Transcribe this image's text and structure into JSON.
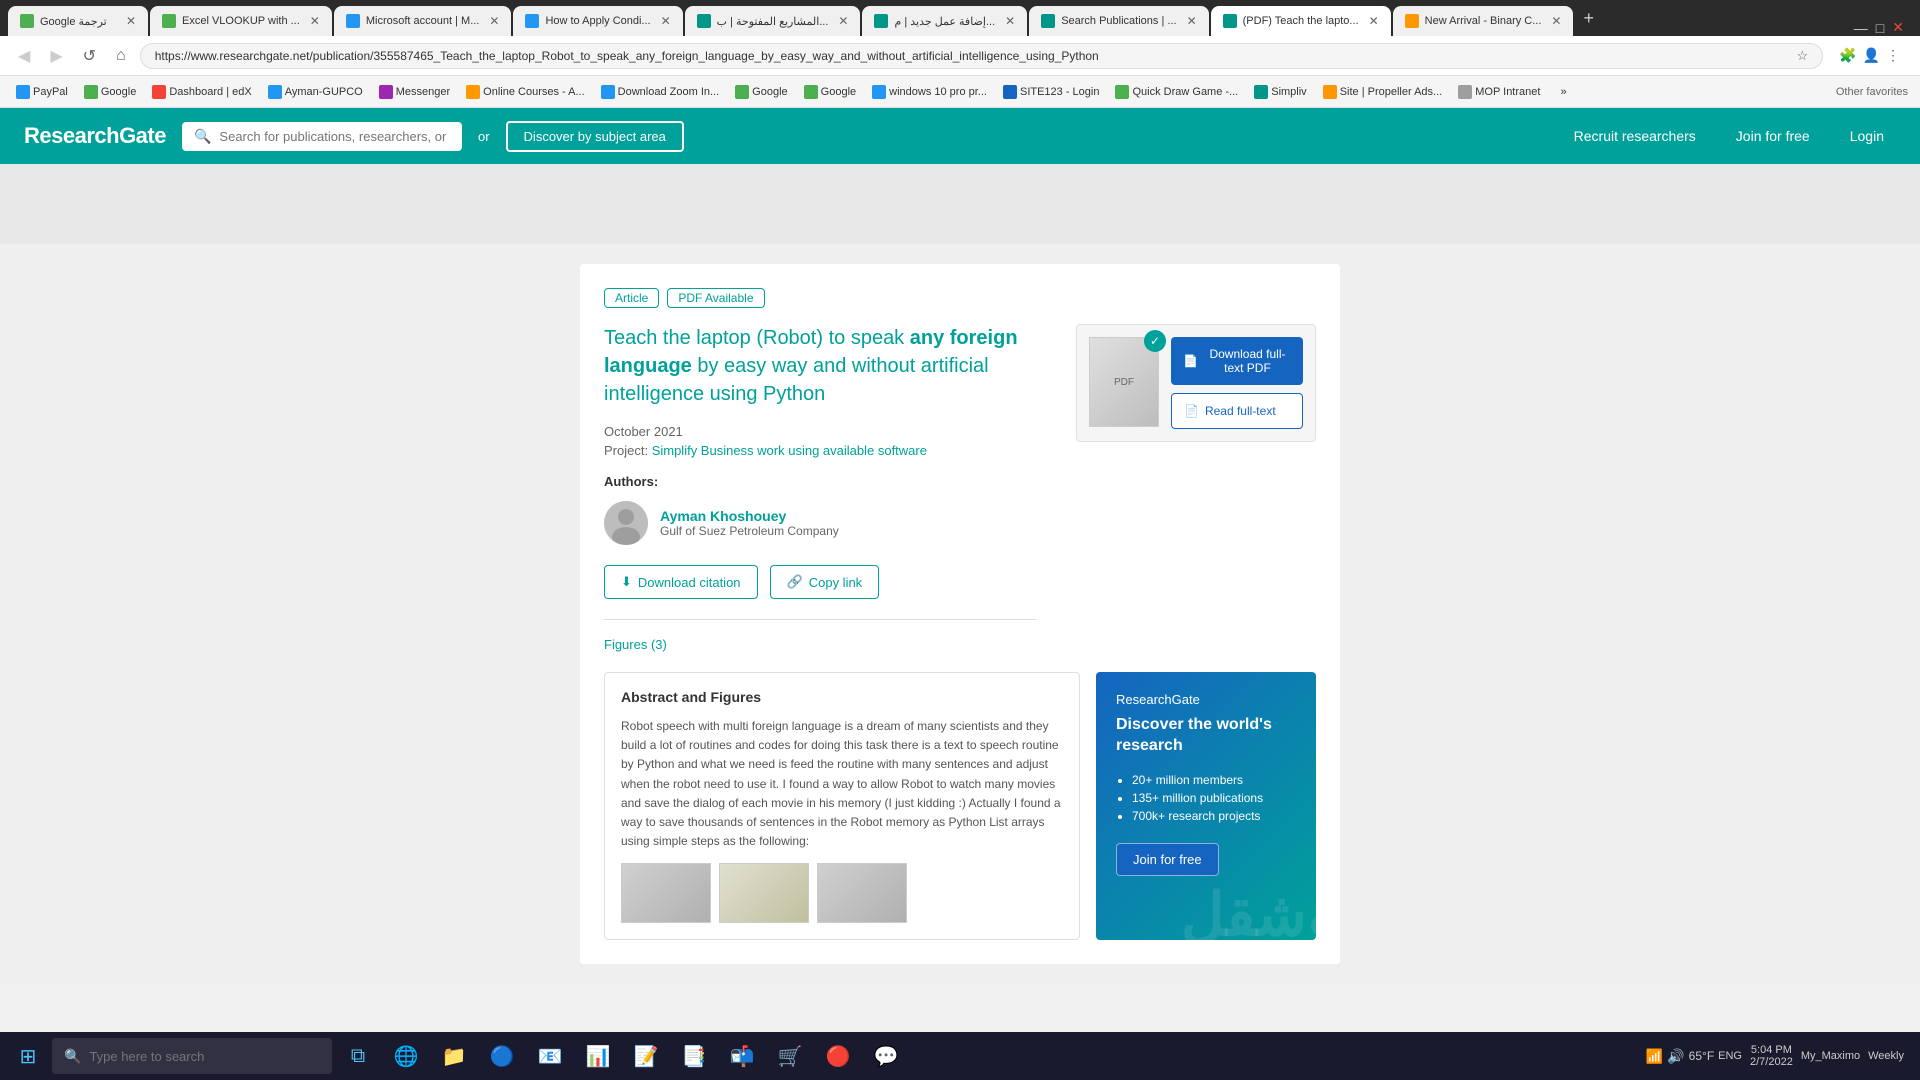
{
  "browser": {
    "tabs": [
      {
        "label": "Google ترجمة",
        "icon": "google",
        "active": false
      },
      {
        "label": "Excel VLOOKUP with ...",
        "icon": "excel",
        "active": false
      },
      {
        "label": "Microsoft account | M...",
        "icon": "ms",
        "active": false
      },
      {
        "label": "How to Apply Condi...",
        "icon": "chrome",
        "active": false
      },
      {
        "label": "المشاريع المفتوحة | ب...",
        "icon": "chrome",
        "active": false
      },
      {
        "label": "إضافة عمل جديد | م...",
        "icon": "chrome",
        "active": false
      },
      {
        "label": "Search Publications | ...",
        "icon": "rg",
        "active": false
      },
      {
        "label": "(PDF) Teach the lapto...",
        "icon": "rg",
        "active": true
      },
      {
        "label": "New Arrival - Binary C...",
        "icon": "chrome",
        "active": false
      }
    ],
    "url": "https://www.researchgate.net/publication/355587465_Teach_the_laptop_Robot_to_speak_any_foreign_language_by_easy_way_and_without_artificial_intelligence_using_Python"
  },
  "bookmarks": [
    {
      "label": "PayPal",
      "color": "blue"
    },
    {
      "label": "Google",
      "color": "green"
    },
    {
      "label": "Dashboard | edX",
      "color": "red"
    },
    {
      "label": "Ayman-GUPCO",
      "color": "blue"
    },
    {
      "label": "Messenger",
      "color": "purple"
    },
    {
      "label": "Online Courses - A...",
      "color": "orange"
    },
    {
      "label": "Download Zoom In...",
      "color": "blue"
    },
    {
      "label": "Google",
      "color": "green"
    },
    {
      "label": "Google",
      "color": "green"
    },
    {
      "label": "windows 10 pro pr...",
      "color": "blue"
    },
    {
      "label": "SITE123 - Login",
      "color": "darkblue"
    },
    {
      "label": "Quick Draw Game -...",
      "color": "green"
    },
    {
      "label": "Simpliv",
      "color": "teal"
    },
    {
      "label": "Site | Propeller Ads...",
      "color": "orange"
    },
    {
      "label": "MOP Intranet",
      "color": "gray"
    }
  ],
  "header": {
    "logo": "ResearchGate",
    "search_placeholder": "Search for publications, researchers, or questions",
    "discover_btn": "Discover by subject area",
    "recruit_btn": "Recruit researchers",
    "join_btn": "Join for free",
    "login_btn": "Login"
  },
  "paper": {
    "tag_article": "Article",
    "tag_pdf": "PDF Available",
    "title_start": "Teach the laptop (Robot) to speak ",
    "title_bold": "any foreign language",
    "title_end": " by easy way and without artificial intelligence using Python",
    "date": "October 2021",
    "project_label": "Project: ",
    "project_link": "Simplify Business work using available software",
    "authors_label": "Authors:",
    "author_name": "Ayman Khoshouey",
    "author_affil": "Gulf of Suez Petroleum Company",
    "download_citation_btn": "Download citation",
    "copy_link_btn": "Copy link",
    "figures_link": "Figures (3)"
  },
  "pdf_panel": {
    "download_btn": "Download full-text PDF",
    "read_btn": "Read full-text"
  },
  "abstract": {
    "title": "Abstract and Figures",
    "text": "Robot speech with multi foreign language is a dream of many scientists and they build a lot of routines and codes for doing this task there is a text to speech routine by Python and what we need is feed the routine with many sentences and adjust when the robot need to use it. I found a way to allow Robot to watch many movies and save the dialog of each movie in his memory (I just kidding :) Actually I found a way to save thousands of sentences in the Robot memory as Python List arrays using simple steps as the following:"
  },
  "promo": {
    "brand": "ResearchGate",
    "title": "Discover the world's research",
    "items": [
      "20+ million members",
      "135+ million publications",
      "700k+ research projects"
    ],
    "join_btn": "Join for free"
  },
  "taskbar": {
    "search_placeholder": "Type here to search",
    "time": "5:04 PM",
    "date": "2/7/2022",
    "language": "ENG",
    "temp": "65°F",
    "profile": "My_Maximo",
    "schedule": "Weekly"
  }
}
